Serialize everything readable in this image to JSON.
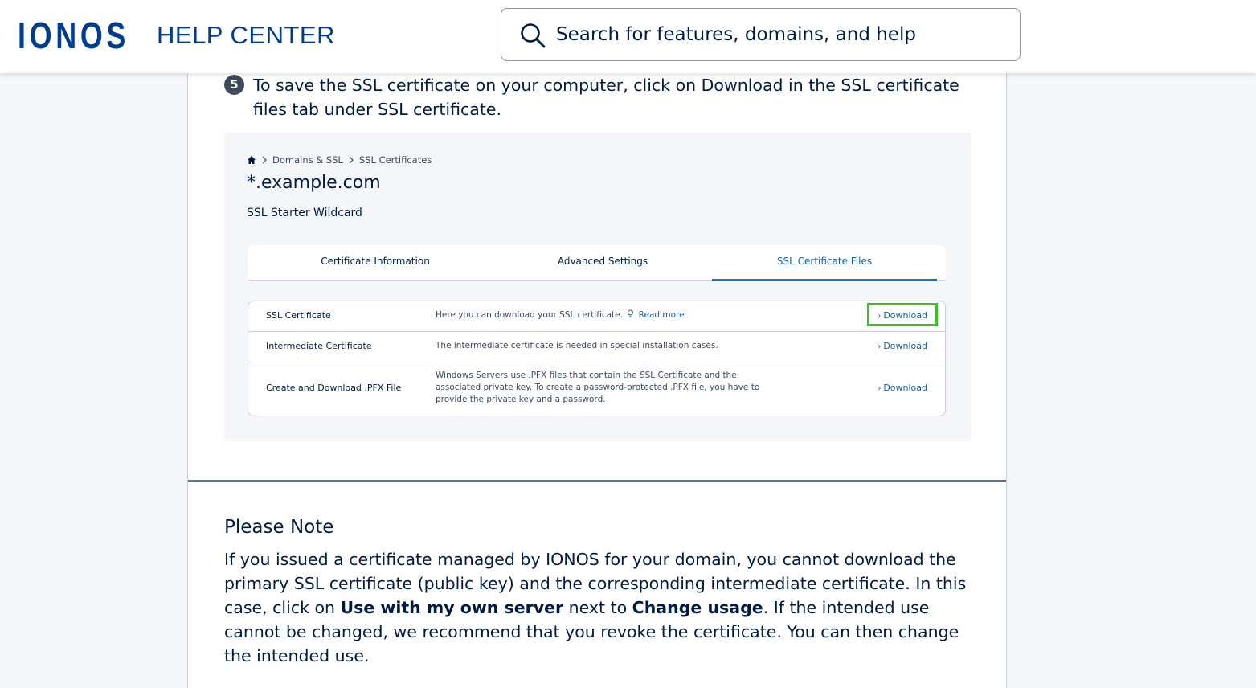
{
  "header": {
    "logo_text": "IONOS",
    "title": "HELP CENTER",
    "search_placeholder": "Search for features, domains, and help"
  },
  "step": {
    "number": "5",
    "text": "To save the SSL certificate on your computer, click on Download in the SSL certificate files tab under SSL certificate."
  },
  "screenshot": {
    "breadcrumb": [
      "Domains & SSL",
      "SSL Certificates"
    ],
    "title": "*.example.com",
    "subtitle": "SSL Starter Wildcard",
    "tabs": [
      {
        "label": "Certificate Information",
        "active": false
      },
      {
        "label": "Advanced Settings",
        "active": false
      },
      {
        "label": "SSL Certificate Files",
        "active": true
      }
    ],
    "rows": [
      {
        "name": "SSL Certificate",
        "description": "Here you can download your SSL certificate.",
        "link": "Read more",
        "action": "Download",
        "highlighted": true
      },
      {
        "name": "Intermediate Certificate",
        "description": "The intermediate certificate is needed in special installation cases.",
        "action": "Download",
        "highlighted": false
      },
      {
        "name": "Create and Download .PFX File",
        "description": "Windows Servers use .PFX files that contain the SSL Certificate and the associated private key. To create a password-protected .PFX file, you have to provide the private key and a password.",
        "action": "Download",
        "highlighted": false
      }
    ]
  },
  "note": {
    "title": "Please Note",
    "text_1": "If you issued a certificate managed by IONOS for your domain, you cannot download the primary SSL certificate (public key) and the corresponding intermediate certificate. In this case, click on ",
    "bold_1": "Use with my own server",
    "text_2": " next to ",
    "bold_2": "Change usage",
    "text_3": ". If the intended use cannot be changed, we recommend that you revoke the certificate. You can then change the intended use."
  },
  "colors": {
    "brand": "#003d8f",
    "text": "#001b41",
    "link": "#1a5fa8",
    "highlight": "#3cc21e"
  }
}
